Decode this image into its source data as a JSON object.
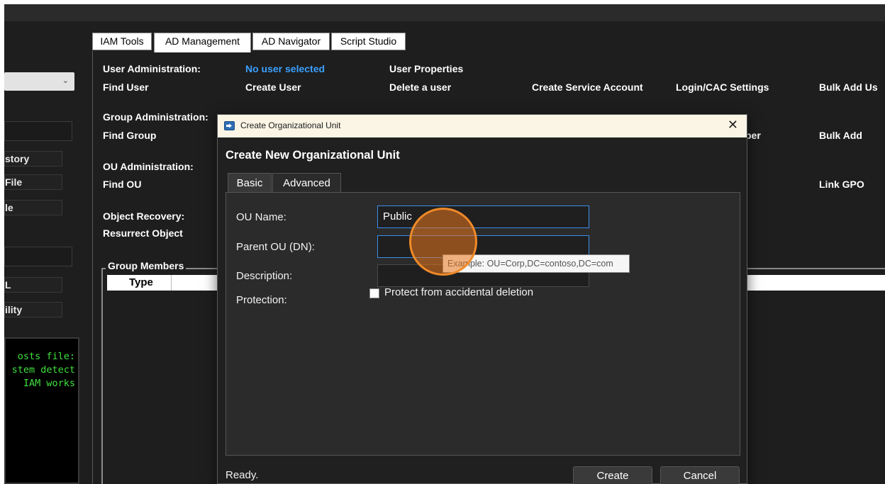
{
  "sidebar": {
    "buttons": [
      "story",
      "File",
      "le",
      "L",
      "ility"
    ],
    "console_lines": [
      "osts file:",
      "stem detect",
      "IAM works"
    ]
  },
  "tabs": [
    "IAM Tools",
    "AD Management",
    "AD Navigator",
    "Script Studio"
  ],
  "user_admin": {
    "heading": "User Administration:",
    "status": "No user selected",
    "properties": "User Properties",
    "find": "Find User",
    "create": "Create User",
    "delete": "Delete a user",
    "service_account": "Create Service Account",
    "login_cac": "Login/CAC Settings",
    "bulk_add": "Bulk Add Us"
  },
  "group_admin": {
    "heading": "Group Administration:",
    "find": "Find Group",
    "member_partial": "ber",
    "bulk_add": "Bulk Add"
  },
  "ou_admin": {
    "heading": "OU Administration:",
    "find": "Find OU",
    "link_gpo": "Link GPO"
  },
  "recovery": {
    "heading": "Object Recovery:",
    "resurrect": "Resurrect Object"
  },
  "group_members": {
    "title": "Group Members",
    "column_type": "Type"
  },
  "dialog": {
    "window_title": "Create Organizational Unit",
    "heading": "Create New Organizational Unit",
    "tabs": [
      "Basic",
      "Advanced"
    ],
    "ou_name_label": "OU Name:",
    "ou_name_value": "Public",
    "parent_ou_label": "Parent OU (DN):",
    "parent_ou_value": "",
    "description_label": "Description:",
    "description_value": "",
    "protection_label": "Protection:",
    "protect_checkbox_label": "Protect from accidental deletion",
    "protect_checked": false,
    "tooltip": "Example: OU=Corp,DC=contoso,DC=com",
    "status": "Ready.",
    "create_button": "Create",
    "cancel_button": "Cancel",
    "close_glyph": "✕"
  },
  "colors": {
    "accent_blue": "#3aa0ff",
    "console_green": "#3ee03e",
    "click_highlight": "#f08a28"
  }
}
